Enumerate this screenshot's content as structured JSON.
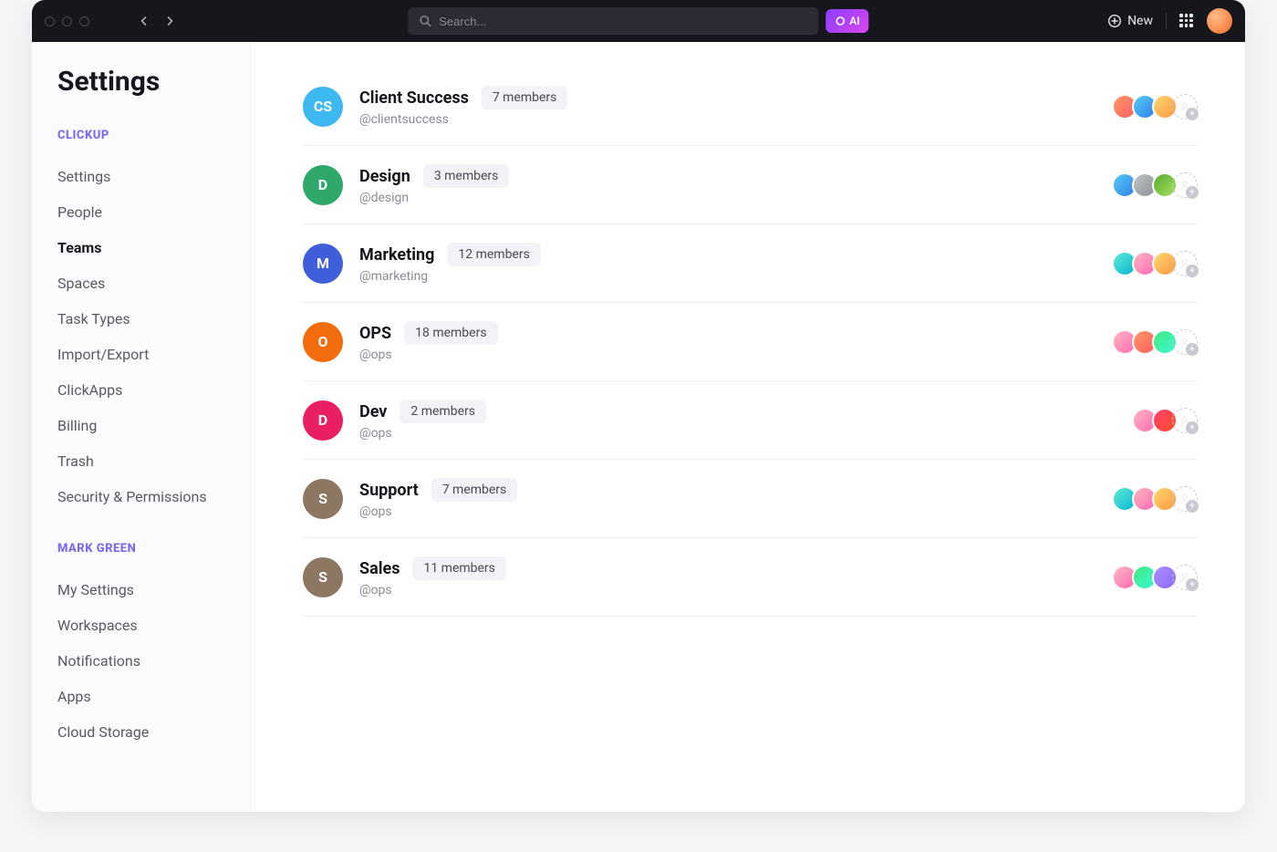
{
  "titlebar": {
    "search_placeholder": "Search...",
    "ai_label": "AI",
    "new_label": "New"
  },
  "sidebar": {
    "title": "Settings",
    "sections": [
      {
        "label": "CLICKUP",
        "items": [
          {
            "label": "Settings",
            "active": false
          },
          {
            "label": "People",
            "active": false
          },
          {
            "label": "Teams",
            "active": true
          },
          {
            "label": "Spaces",
            "active": false
          },
          {
            "label": "Task Types",
            "active": false
          },
          {
            "label": "Import/Export",
            "active": false
          },
          {
            "label": "ClickApps",
            "active": false
          },
          {
            "label": "Billing",
            "active": false
          },
          {
            "label": "Trash",
            "active": false
          },
          {
            "label": "Security & Permissions",
            "active": false
          }
        ]
      },
      {
        "label": "MARK GREEN",
        "items": [
          {
            "label": "My Settings",
            "active": false
          },
          {
            "label": "Workspaces",
            "active": false
          },
          {
            "label": "Notifications",
            "active": false
          },
          {
            "label": "Apps",
            "active": false
          },
          {
            "label": "Cloud Storage",
            "active": false
          }
        ]
      }
    ]
  },
  "teams": [
    {
      "name": "Client Success",
      "handle": "@clientsuccess",
      "members_label": "7 members",
      "initials": "CS",
      "color": "#3EB8F0",
      "avatars": [
        "orange",
        "blue",
        "yellow"
      ]
    },
    {
      "name": "Design",
      "handle": "@design",
      "members_label": "3 members",
      "initials": "D",
      "color": "#2EA86B",
      "avatars": [
        "blue",
        "grey",
        "green"
      ]
    },
    {
      "name": "Marketing",
      "handle": "@marketing",
      "members_label": "12 members",
      "initials": "M",
      "color": "#3E5FD9",
      "avatars": [
        "cyan",
        "pink",
        "yellow"
      ]
    },
    {
      "name": "OPS",
      "handle": "@ops",
      "members_label": "18 members",
      "initials": "O",
      "color": "#F26C0C",
      "avatars": [
        "pink",
        "orange",
        "teal"
      ]
    },
    {
      "name": "Dev",
      "handle": "@ops",
      "members_label": "2 members",
      "initials": "D",
      "color": "#E91E63",
      "avatars": [
        "pink",
        "red"
      ]
    },
    {
      "name": "Support",
      "handle": "@ops",
      "members_label": "7 members",
      "initials": "S",
      "color": "#8C7763",
      "avatars": [
        "cyan",
        "pink",
        "yellow"
      ]
    },
    {
      "name": "Sales",
      "handle": "@ops",
      "members_label": "11 members",
      "initials": "S",
      "color": "#8C7763",
      "avatars": [
        "pink",
        "teal",
        "purple"
      ]
    }
  ]
}
